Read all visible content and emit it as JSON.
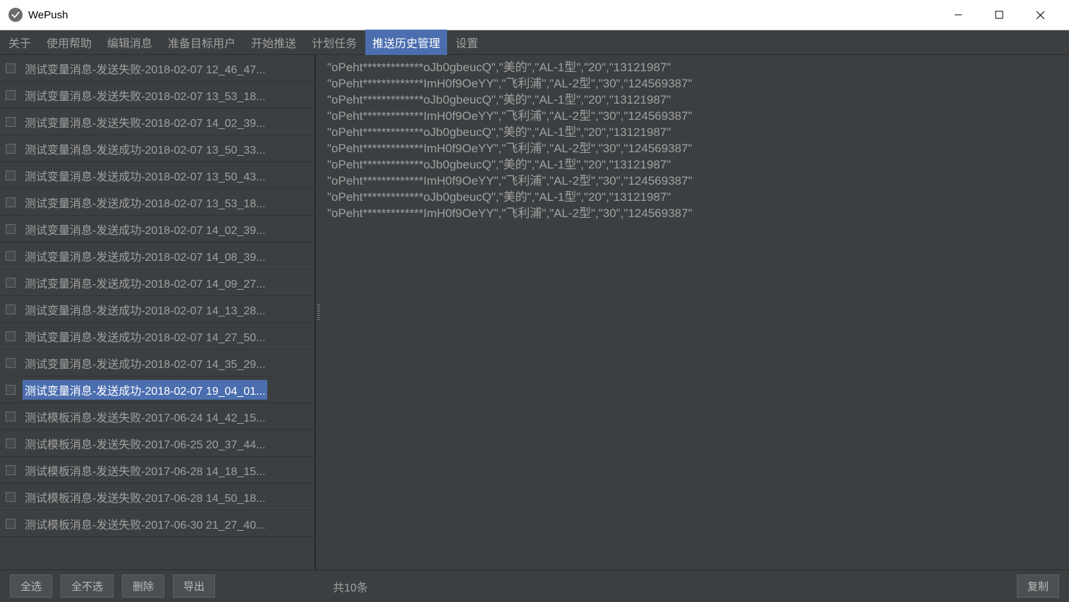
{
  "window": {
    "title": "WePush"
  },
  "menubar": {
    "items": [
      "关于",
      "使用帮助",
      "编辑消息",
      "准备目标用户",
      "开始推送",
      "计划任务",
      "推送历史管理",
      "设置"
    ],
    "active_index": 6
  },
  "history": {
    "selected_index": 12,
    "items": [
      "测试变量消息-发送失败-2018-02-07 12_46_47...",
      "测试变量消息-发送失败-2018-02-07 13_53_18...",
      "测试变量消息-发送失败-2018-02-07 14_02_39...",
      "测试变量消息-发送成功-2018-02-07 13_50_33...",
      "测试变量消息-发送成功-2018-02-07 13_50_43...",
      "测试变量消息-发送成功-2018-02-07 13_53_18...",
      "测试变量消息-发送成功-2018-02-07 14_02_39...",
      "测试变量消息-发送成功-2018-02-07 14_08_39...",
      "测试变量消息-发送成功-2018-02-07 14_09_27...",
      "测试变量消息-发送成功-2018-02-07 14_13_28...",
      "测试变量消息-发送成功-2018-02-07 14_27_50...",
      "测试变量消息-发送成功-2018-02-07 14_35_29...",
      "测试变量消息-发送成功-2018-02-07 19_04_01...",
      "测试模板消息-发送失败-2017-06-24 14_42_15...",
      "测试模板消息-发送失败-2017-06-25 20_37_44...",
      "测试模板消息-发送失败-2017-06-28 14_18_15...",
      "测试模板消息-发送失败-2017-06-28 14_50_18...",
      "测试模板消息-发送失败-2017-06-30 21_27_40..."
    ]
  },
  "log_lines": [
    "\"oPeht*************oJb0gbeucQ\",\"美的\",\"AL-1型\",\"20\",\"13121987\"",
    "\"oPeht*************ImH0f9OeYY\",\"飞利浦\",\"AL-2型\",\"30\",\"124569387\"",
    "\"oPeht*************oJb0gbeucQ\",\"美的\",\"AL-1型\",\"20\",\"13121987\"",
    "\"oPeht*************ImH0f9OeYY\",\"飞利浦\",\"AL-2型\",\"30\",\"124569387\"",
    "\"oPeht*************oJb0gbeucQ\",\"美的\",\"AL-1型\",\"20\",\"13121987\"",
    "\"oPeht*************ImH0f9OeYY\",\"飞利浦\",\"AL-2型\",\"30\",\"124569387\"",
    "\"oPeht*************oJb0gbeucQ\",\"美的\",\"AL-1型\",\"20\",\"13121987\"",
    "\"oPeht*************ImH0f9OeYY\",\"飞利浦\",\"AL-2型\",\"30\",\"124569387\"",
    "\"oPeht*************oJb0gbeucQ\",\"美的\",\"AL-1型\",\"20\",\"13121987\"",
    "\"oPeht*************ImH0f9OeYY\",\"飞利浦\",\"AL-2型\",\"30\",\"124569387\""
  ],
  "buttons": {
    "select_all": "全选",
    "deselect_all": "全不选",
    "delete": "删除",
    "export": "导出",
    "copy": "复制"
  },
  "status": {
    "count_label": "共10条"
  }
}
